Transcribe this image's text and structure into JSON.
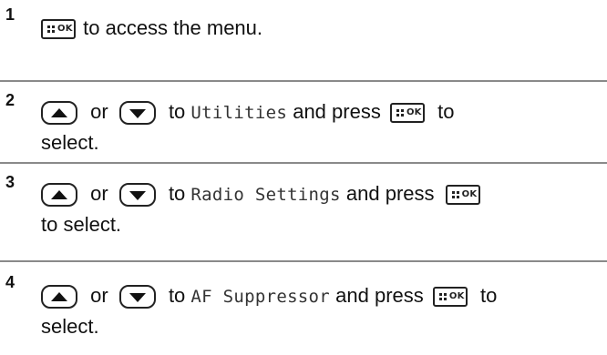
{
  "steps": [
    {
      "number": "1",
      "line1": {
        "text_a": "to access the menu."
      }
    },
    {
      "number": "2",
      "or": "or",
      "to": "to",
      "menu_item": "Utilities",
      "and_press": "and press",
      "tail": "to",
      "line2": "select."
    },
    {
      "number": "3",
      "or": "or",
      "to": "to",
      "menu_item": "Radio Settings",
      "and_press": "and press",
      "line2": "to select."
    },
    {
      "number": "4",
      "or": "or",
      "to": "to",
      "menu_item": "AF Suppressor",
      "and_press": "and press",
      "tail": "to",
      "line2": "select."
    }
  ],
  "icons": {
    "menu_ok_key": "menu-ok-key-icon",
    "up_key": "up-arrow-key-icon",
    "down_key": "down-arrow-key-icon",
    "menu_ok_label": "OK"
  }
}
